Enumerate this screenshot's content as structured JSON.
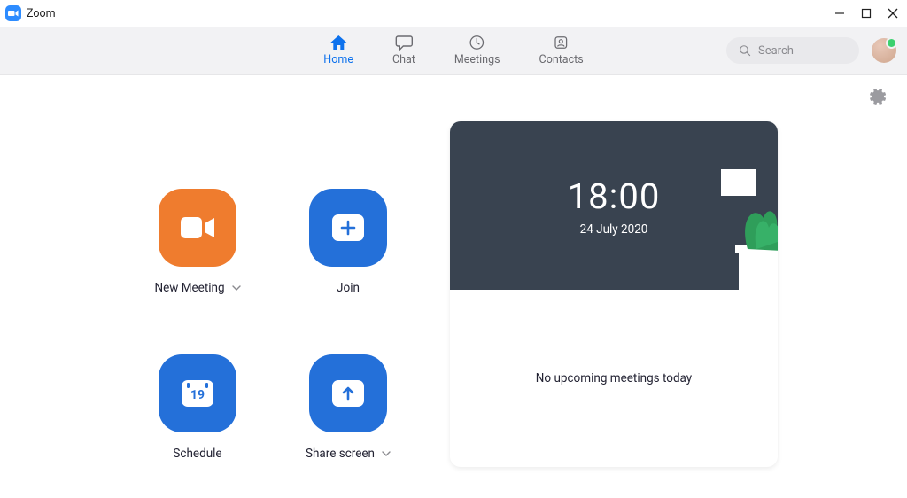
{
  "window": {
    "title": "Zoom"
  },
  "nav": {
    "tabs": [
      {
        "label": "Home",
        "active": true
      },
      {
        "label": "Chat",
        "active": false
      },
      {
        "label": "Meetings",
        "active": false
      },
      {
        "label": "Contacts",
        "active": false
      }
    ],
    "search_placeholder": "Search"
  },
  "actions": {
    "new_meeting": "New Meeting",
    "join": "Join",
    "schedule": "Schedule",
    "schedule_day": "19",
    "share_screen": "Share screen"
  },
  "panel": {
    "time": "18:00",
    "date": "24 July 2020",
    "empty_msg": "No upcoming meetings today"
  }
}
